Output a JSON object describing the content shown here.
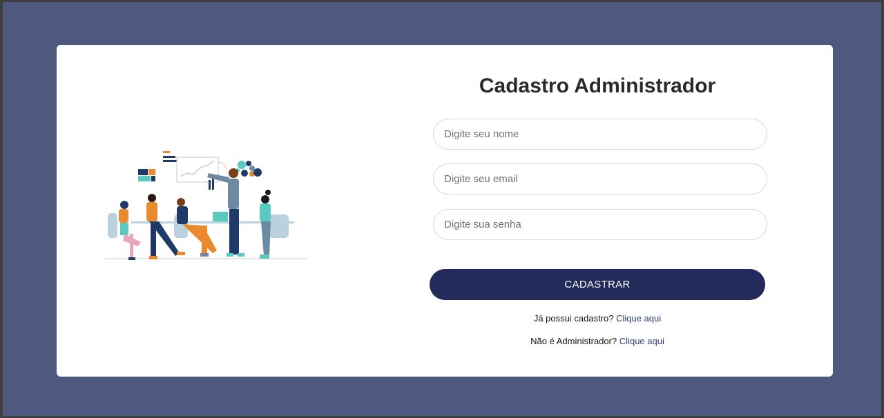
{
  "form": {
    "title": "Cadastro Administrador",
    "name_placeholder": "Digite seu nome",
    "email_placeholder": "Digite seu email",
    "password_placeholder": "Digite sua senha",
    "submit_label": "CADASTRAR"
  },
  "links": {
    "login_text": "Já possui cadastro?",
    "login_link": "Clique aqui",
    "not_admin_text": "Não é Administrador?",
    "not_admin_link": "Clique aqui"
  },
  "illustration": {
    "name": "team-meeting-illustration",
    "colors": {
      "navy": "#1f3a68",
      "orange": "#e98a2e",
      "teal": "#5cc9c0",
      "pink": "#e8a6b8",
      "slate": "#6d8aa3",
      "chair": "#b9d2de"
    }
  },
  "colors": {
    "background": "#4f587f",
    "card": "#ffffff",
    "button": "#222b5c",
    "link": "#2a3a7a"
  }
}
